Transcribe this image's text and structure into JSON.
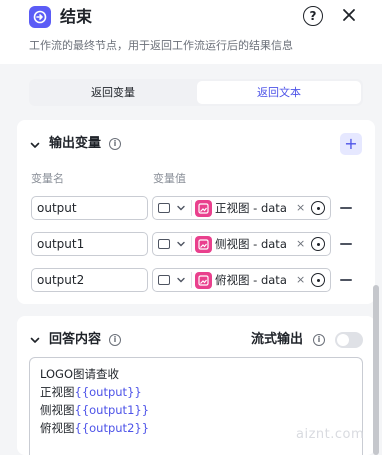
{
  "header": {
    "icon": "end-node-icon",
    "title": "结束",
    "help_label": "?",
    "description": "工作流的最终节点，用于返回工作流运行后的结果信息"
  },
  "tabs": [
    {
      "label": "返回变量",
      "active": false
    },
    {
      "label": "返回文本",
      "active": true
    }
  ],
  "output_section": {
    "title": "输出变量",
    "col_name": "变量名",
    "col_value": "变量值",
    "add_label": "+",
    "rows": [
      {
        "name": "output",
        "value_ref": "正视图 - data",
        "clear": "×"
      },
      {
        "name": "output1",
        "value_ref": "侧视图 - data",
        "clear": "×"
      },
      {
        "name": "output2",
        "value_ref": "俯视图 - data",
        "clear": "×"
      }
    ]
  },
  "answer_section": {
    "title": "回答内容",
    "stream_label": "流式输出",
    "stream_enabled": false,
    "lines": [
      {
        "prefix": "LOGO图请查收",
        "var": ""
      },
      {
        "prefix": "正视图",
        "var": "{{output}}"
      },
      {
        "prefix": "侧视图",
        "var": "{{output1}}"
      },
      {
        "prefix": "俯视图",
        "var": "{{output2}}"
      }
    ]
  },
  "watermark": "aiznt.com",
  "colors": {
    "accent": "#4d53e8",
    "node_icon": "#e9408d",
    "logo": "#5b5cf6"
  }
}
